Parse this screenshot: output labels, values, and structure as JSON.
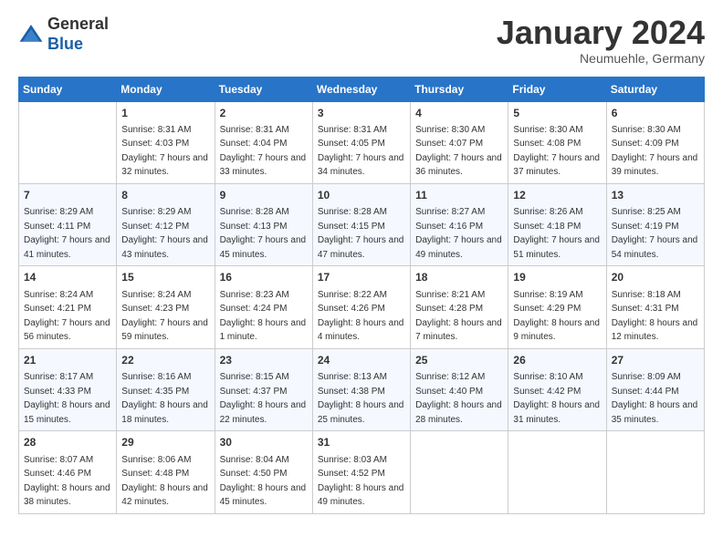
{
  "header": {
    "logo_line1": "General",
    "logo_line2": "Blue",
    "month": "January 2024",
    "location": "Neumuehle, Germany"
  },
  "days_of_week": [
    "Sunday",
    "Monday",
    "Tuesday",
    "Wednesday",
    "Thursday",
    "Friday",
    "Saturday"
  ],
  "weeks": [
    [
      {
        "day": "",
        "sunrise": "",
        "sunset": "",
        "daylight": ""
      },
      {
        "day": "1",
        "sunrise": "Sunrise: 8:31 AM",
        "sunset": "Sunset: 4:03 PM",
        "daylight": "Daylight: 7 hours and 32 minutes."
      },
      {
        "day": "2",
        "sunrise": "Sunrise: 8:31 AM",
        "sunset": "Sunset: 4:04 PM",
        "daylight": "Daylight: 7 hours and 33 minutes."
      },
      {
        "day": "3",
        "sunrise": "Sunrise: 8:31 AM",
        "sunset": "Sunset: 4:05 PM",
        "daylight": "Daylight: 7 hours and 34 minutes."
      },
      {
        "day": "4",
        "sunrise": "Sunrise: 8:30 AM",
        "sunset": "Sunset: 4:07 PM",
        "daylight": "Daylight: 7 hours and 36 minutes."
      },
      {
        "day": "5",
        "sunrise": "Sunrise: 8:30 AM",
        "sunset": "Sunset: 4:08 PM",
        "daylight": "Daylight: 7 hours and 37 minutes."
      },
      {
        "day": "6",
        "sunrise": "Sunrise: 8:30 AM",
        "sunset": "Sunset: 4:09 PM",
        "daylight": "Daylight: 7 hours and 39 minutes."
      }
    ],
    [
      {
        "day": "7",
        "sunrise": "Sunrise: 8:29 AM",
        "sunset": "Sunset: 4:11 PM",
        "daylight": "Daylight: 7 hours and 41 minutes."
      },
      {
        "day": "8",
        "sunrise": "Sunrise: 8:29 AM",
        "sunset": "Sunset: 4:12 PM",
        "daylight": "Daylight: 7 hours and 43 minutes."
      },
      {
        "day": "9",
        "sunrise": "Sunrise: 8:28 AM",
        "sunset": "Sunset: 4:13 PM",
        "daylight": "Daylight: 7 hours and 45 minutes."
      },
      {
        "day": "10",
        "sunrise": "Sunrise: 8:28 AM",
        "sunset": "Sunset: 4:15 PM",
        "daylight": "Daylight: 7 hours and 47 minutes."
      },
      {
        "day": "11",
        "sunrise": "Sunrise: 8:27 AM",
        "sunset": "Sunset: 4:16 PM",
        "daylight": "Daylight: 7 hours and 49 minutes."
      },
      {
        "day": "12",
        "sunrise": "Sunrise: 8:26 AM",
        "sunset": "Sunset: 4:18 PM",
        "daylight": "Daylight: 7 hours and 51 minutes."
      },
      {
        "day": "13",
        "sunrise": "Sunrise: 8:25 AM",
        "sunset": "Sunset: 4:19 PM",
        "daylight": "Daylight: 7 hours and 54 minutes."
      }
    ],
    [
      {
        "day": "14",
        "sunrise": "Sunrise: 8:24 AM",
        "sunset": "Sunset: 4:21 PM",
        "daylight": "Daylight: 7 hours and 56 minutes."
      },
      {
        "day": "15",
        "sunrise": "Sunrise: 8:24 AM",
        "sunset": "Sunset: 4:23 PM",
        "daylight": "Daylight: 7 hours and 59 minutes."
      },
      {
        "day": "16",
        "sunrise": "Sunrise: 8:23 AM",
        "sunset": "Sunset: 4:24 PM",
        "daylight": "Daylight: 8 hours and 1 minute."
      },
      {
        "day": "17",
        "sunrise": "Sunrise: 8:22 AM",
        "sunset": "Sunset: 4:26 PM",
        "daylight": "Daylight: 8 hours and 4 minutes."
      },
      {
        "day": "18",
        "sunrise": "Sunrise: 8:21 AM",
        "sunset": "Sunset: 4:28 PM",
        "daylight": "Daylight: 8 hours and 7 minutes."
      },
      {
        "day": "19",
        "sunrise": "Sunrise: 8:19 AM",
        "sunset": "Sunset: 4:29 PM",
        "daylight": "Daylight: 8 hours and 9 minutes."
      },
      {
        "day": "20",
        "sunrise": "Sunrise: 8:18 AM",
        "sunset": "Sunset: 4:31 PM",
        "daylight": "Daylight: 8 hours and 12 minutes."
      }
    ],
    [
      {
        "day": "21",
        "sunrise": "Sunrise: 8:17 AM",
        "sunset": "Sunset: 4:33 PM",
        "daylight": "Daylight: 8 hours and 15 minutes."
      },
      {
        "day": "22",
        "sunrise": "Sunrise: 8:16 AM",
        "sunset": "Sunset: 4:35 PM",
        "daylight": "Daylight: 8 hours and 18 minutes."
      },
      {
        "day": "23",
        "sunrise": "Sunrise: 8:15 AM",
        "sunset": "Sunset: 4:37 PM",
        "daylight": "Daylight: 8 hours and 22 minutes."
      },
      {
        "day": "24",
        "sunrise": "Sunrise: 8:13 AM",
        "sunset": "Sunset: 4:38 PM",
        "daylight": "Daylight: 8 hours and 25 minutes."
      },
      {
        "day": "25",
        "sunrise": "Sunrise: 8:12 AM",
        "sunset": "Sunset: 4:40 PM",
        "daylight": "Daylight: 8 hours and 28 minutes."
      },
      {
        "day": "26",
        "sunrise": "Sunrise: 8:10 AM",
        "sunset": "Sunset: 4:42 PM",
        "daylight": "Daylight: 8 hours and 31 minutes."
      },
      {
        "day": "27",
        "sunrise": "Sunrise: 8:09 AM",
        "sunset": "Sunset: 4:44 PM",
        "daylight": "Daylight: 8 hours and 35 minutes."
      }
    ],
    [
      {
        "day": "28",
        "sunrise": "Sunrise: 8:07 AM",
        "sunset": "Sunset: 4:46 PM",
        "daylight": "Daylight: 8 hours and 38 minutes."
      },
      {
        "day": "29",
        "sunrise": "Sunrise: 8:06 AM",
        "sunset": "Sunset: 4:48 PM",
        "daylight": "Daylight: 8 hours and 42 minutes."
      },
      {
        "day": "30",
        "sunrise": "Sunrise: 8:04 AM",
        "sunset": "Sunset: 4:50 PM",
        "daylight": "Daylight: 8 hours and 45 minutes."
      },
      {
        "day": "31",
        "sunrise": "Sunrise: 8:03 AM",
        "sunset": "Sunset: 4:52 PM",
        "daylight": "Daylight: 8 hours and 49 minutes."
      },
      {
        "day": "",
        "sunrise": "",
        "sunset": "",
        "daylight": ""
      },
      {
        "day": "",
        "sunrise": "",
        "sunset": "",
        "daylight": ""
      },
      {
        "day": "",
        "sunrise": "",
        "sunset": "",
        "daylight": ""
      }
    ]
  ]
}
